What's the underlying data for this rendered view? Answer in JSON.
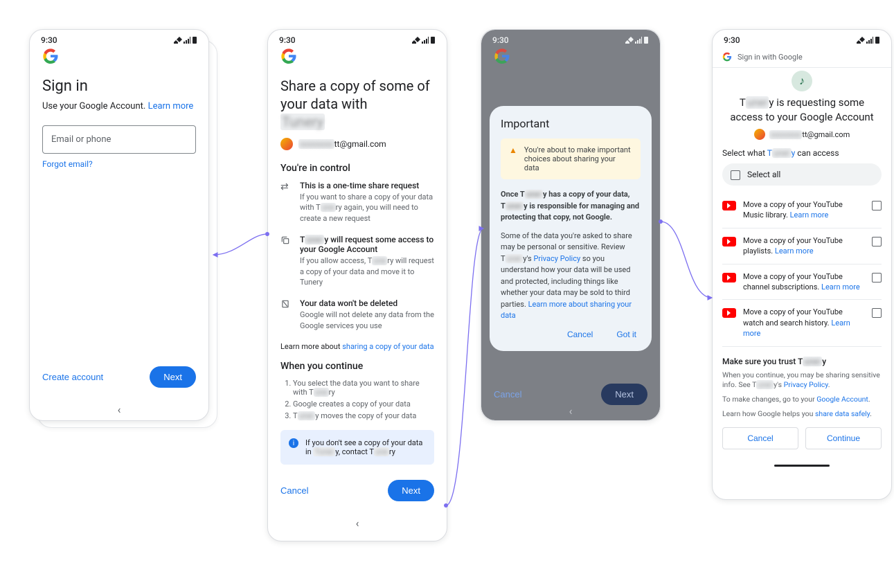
{
  "status_time": "9:30",
  "screen1": {
    "title": "Sign in",
    "subtitle": "Use your Google Account.",
    "learn_more": "Learn more",
    "placeholder": "Email or phone",
    "forgot": "Forgot email?",
    "create": "Create account",
    "next": "Next"
  },
  "screen2": {
    "title": "Share a copy of some of your data with",
    "email_suffix": "tt@gmail.com",
    "control_h": "You're in control",
    "item1_t": "This is a one-time share request",
    "item1_d_a": "If you want to share a copy of your data with T",
    "item1_d_b": "ry again, you will need to create a new request",
    "item2_t_a": "T",
    "item2_t_b": "y will request some access to your Google Account",
    "item2_d_a": "If you allow access, T",
    "item2_d_b": "ry will request a copy of your data and move it to Tunery",
    "item3_t": "Your data won't be deleted",
    "item3_d": "Google will not delete any data from the Google services you use",
    "learn_pre": "Learn more about ",
    "learn_link": "sharing a copy of your data",
    "continue_h": "When you continue",
    "step1_a": "You select the data you want to share with T",
    "step1_b": "ry",
    "step2": "Google creates a copy of your data",
    "step3_a": "T",
    "step3_b": "y moves the copy of your data",
    "callout_a": "If you don't see a copy of your data in ",
    "callout_b": "y, contact T",
    "callout_c": "ry",
    "cancel": "Cancel",
    "next": "Next"
  },
  "screen3": {
    "modal_title": "Important",
    "warn": "You're about to make important choices about sharing your data",
    "p1_a": "Once T",
    "p1_b": "y has a copy of your data, T",
    "p1_c": "y is responsible for managing and protecting that copy, not Google.",
    "p2_a": "Some of the data you're asked to share may be personal or sensitive. Review T",
    "p2_b": "y's ",
    "p2_link1": "Privacy Policy",
    "p2_c": " so you understand how your data will be used and protected, including things like whether your data may be sold to third parties. ",
    "p2_link2": "Learn more about sharing your data",
    "cancel": "Cancel",
    "gotit": "Got it",
    "bg_next": "Next",
    "bg_cancel": "Cancel"
  },
  "screen4": {
    "siw": "Sign in with Google",
    "title_a": "T",
    "title_b": "y is requesting some access to your Google Account",
    "email_suffix": "tt@gmail.com",
    "select_h_a": "Select what ",
    "select_h_app": "T",
    "select_h_b": "y",
    "select_h_c": " can access",
    "select_all": "Select all",
    "perm1": "Move a copy of your YouTube Music library. ",
    "perm2": "Move a copy of your YouTube playlists. ",
    "perm3": "Move a copy of your YouTube channel subscriptions. ",
    "perm4": "Move a copy of your YouTube watch and search history. ",
    "learn_more": "Learn more",
    "trust_h_a": "Make sure you trust T",
    "trust_h_b": "y",
    "trust1_a": "When you continue, you may be sharing sensitive info. See T",
    "trust1_b": "y's ",
    "trust1_link": "Privacy Policy",
    "trust2_a": "To make changes, go to your ",
    "trust2_link": "Google Account",
    "trust3_a": "Learn how Google helps you ",
    "trust3_link": "share data safely",
    "cancel": "Cancel",
    "continue": "Continue"
  }
}
